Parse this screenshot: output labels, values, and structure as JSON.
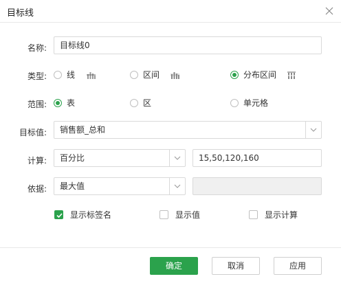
{
  "dialog": {
    "title": "目标线"
  },
  "name_row": {
    "label": "名称:",
    "value": "目标线0"
  },
  "type_row": {
    "label": "类型:",
    "options": [
      {
        "label": "线",
        "checked": false,
        "icon": "line-chart-icon"
      },
      {
        "label": "区间",
        "checked": false,
        "icon": "range-chart-icon"
      },
      {
        "label": "分布区间",
        "checked": true,
        "icon": "distribution-chart-icon"
      }
    ]
  },
  "scope_row": {
    "label": "范围:",
    "options": [
      {
        "label": "表",
        "checked": true
      },
      {
        "label": "区",
        "checked": false
      },
      {
        "label": "单元格",
        "checked": false
      }
    ]
  },
  "target_row": {
    "label": "目标值:",
    "value": "销售额_总和"
  },
  "calc_row": {
    "label": "计算:",
    "method": "百分比",
    "values": "15,50,120,160"
  },
  "basis_row": {
    "label": "依据:",
    "method": "最大值",
    "value": ""
  },
  "checkboxes": [
    {
      "label": "显示标签名",
      "checked": true
    },
    {
      "label": "显示值",
      "checked": false
    },
    {
      "label": "显示计算",
      "checked": false
    }
  ],
  "footer": {
    "ok": "确定",
    "cancel": "取消",
    "apply": "应用"
  },
  "colors": {
    "accent": "#2ba24c",
    "border": "#d9d9d9",
    "disabled_bg": "#f0f0f0"
  }
}
